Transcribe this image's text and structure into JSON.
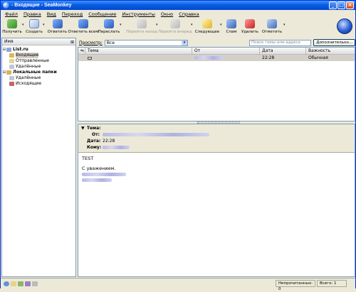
{
  "window": {
    "title": "- Входящие - SeaMonkey",
    "controls": {
      "minimize": "_",
      "maximize": "□",
      "close": "×"
    }
  },
  "menu": [
    "Файл",
    "Правка",
    "Вид",
    "Переход",
    "Сообщение",
    "Инструменты",
    "Окно",
    "Справка"
  ],
  "toolbar": {
    "get": "Получить",
    "compose": "Создать",
    "reply": "Ответить",
    "reply_all": "Ответить всем",
    "forward": "Переслать",
    "back": "Перейти назад",
    "forward_nav": "Перейти вперед",
    "next": "Следующее",
    "spam": "Спам",
    "delete": "Удалить",
    "mark": "Отметить",
    "dropdown_glyph": "▾"
  },
  "search": {
    "view_label": "Просмотр:",
    "view_value": "Все",
    "placeholder": "Поиск темы или адреса",
    "advanced": "Дополнительно..."
  },
  "folders": {
    "header": "Имя",
    "items": [
      {
        "label": "List.ru",
        "bold": true
      },
      {
        "label": "Входящие",
        "selected": true
      },
      {
        "label": "Отправленные"
      },
      {
        "label": "Удалённые"
      },
      {
        "label": "Локальные папки",
        "bold": true
      },
      {
        "label": "Удалённые"
      },
      {
        "label": "Исходящие"
      }
    ]
  },
  "thread": {
    "columns": {
      "subject": "Тема",
      "from": "От",
      "date": "Дата",
      "importance": "Важность"
    },
    "rows": [
      {
        "date": "22:28",
        "importance": "Обычная"
      }
    ]
  },
  "message": {
    "labels": {
      "subject": "Тема:",
      "from": "От:",
      "date": "Дата:",
      "to": "Кому:"
    },
    "date": "22:28",
    "body": [
      "TEST",
      "С уважением."
    ]
  },
  "status": {
    "unread": "Непрочитанных: 0",
    "total": "Всего: 1"
  },
  "colors": {
    "titlebar": "#0a5de0",
    "selected_row": "#d4d0c8",
    "pane_border": "#7f9db9"
  }
}
